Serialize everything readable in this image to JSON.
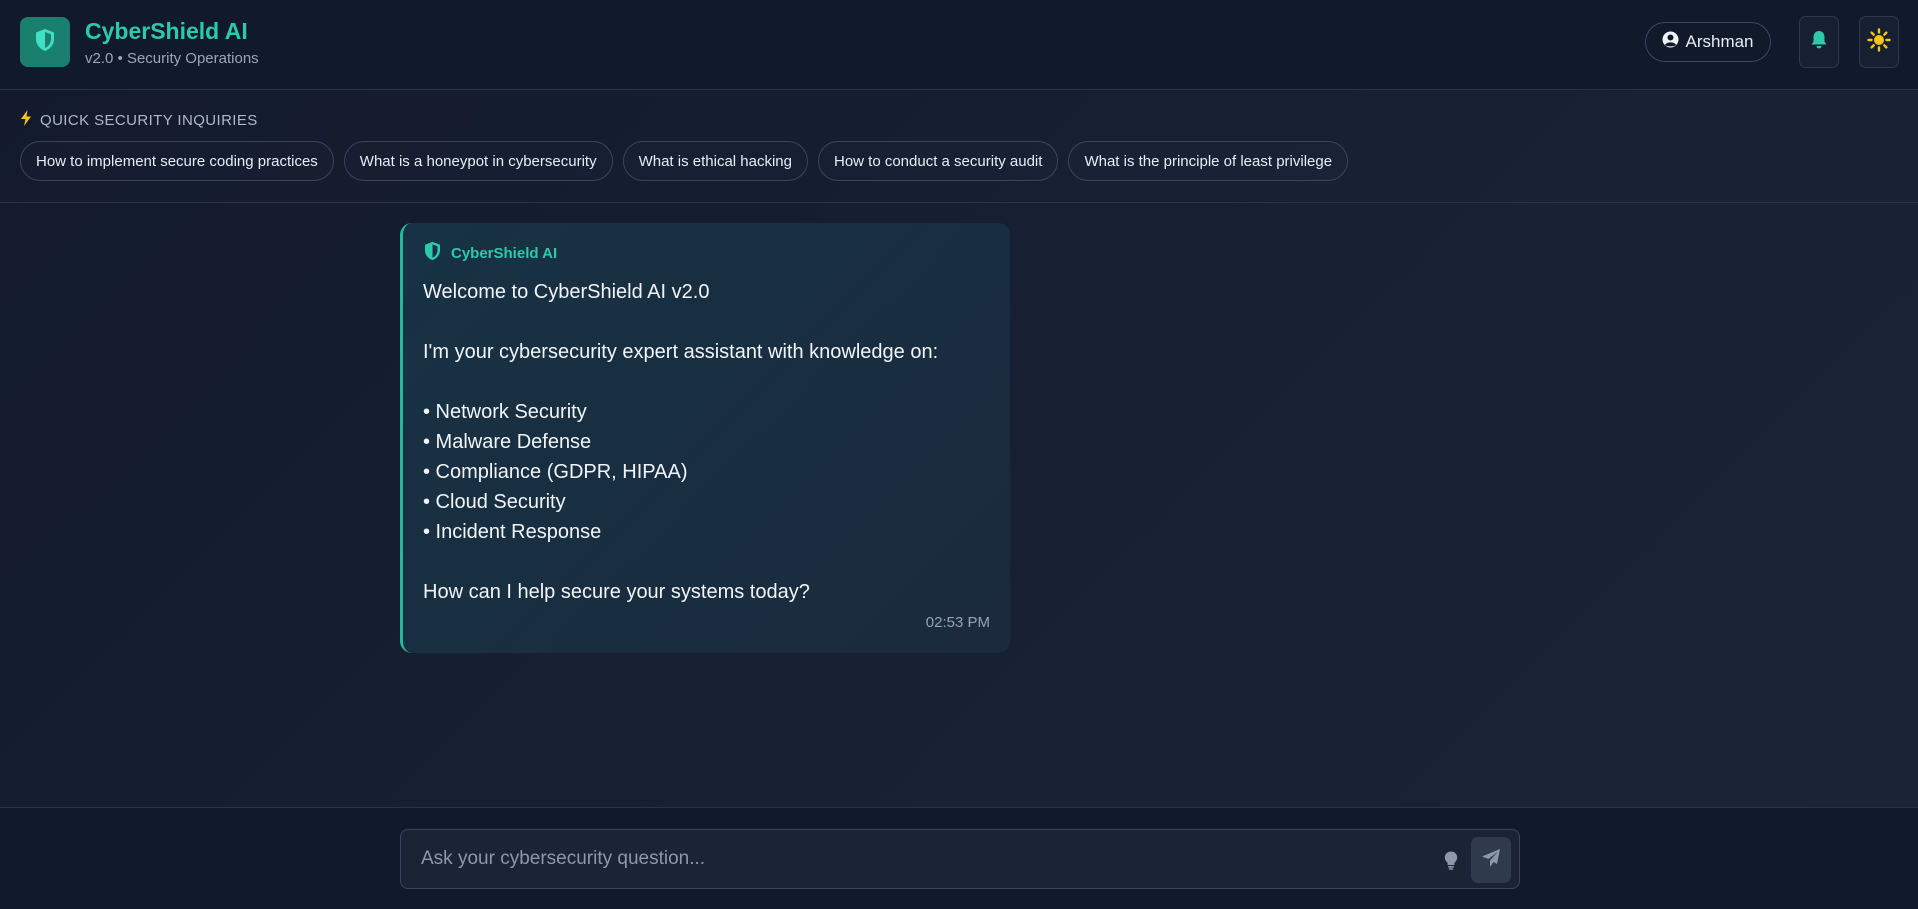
{
  "header": {
    "app_title": "CyberShield AI",
    "app_subtitle": "v2.0 • Security Operations",
    "logo_icon": "shield-icon",
    "user_name": "Arshman",
    "user_icon": "user-circle-icon",
    "notification_icon": "bell-icon",
    "theme_icon": "sun-icon"
  },
  "quick": {
    "heading": "QUICK SECURITY INQUIRIES",
    "heading_icon": "lightning-icon",
    "chips": [
      "How to implement secure coding practices",
      "What is a honeypot in cybersecurity",
      "What is ethical hacking",
      "How to conduct a security audit",
      "What is the principle of least privilege"
    ]
  },
  "message": {
    "sender": "CyberShield AI",
    "sender_icon": "shield-icon",
    "lines": [
      "Welcome to CyberShield AI v2.0",
      "",
      "I'm your cybersecurity expert assistant with knowledge on:",
      "",
      "• Network Security",
      "• Malware Defense",
      "• Compliance (GDPR, HIPAA)",
      "• Cloud Security",
      "• Incident Response",
      "",
      "How can I help secure your systems today?"
    ],
    "time": "02:53 PM"
  },
  "input": {
    "placeholder": "Ask your cybersecurity question...",
    "value": "",
    "suggest_icon": "lightbulb-icon",
    "send_icon": "paper-plane-icon"
  },
  "colors": {
    "accent": "#2cc9ab",
    "background": "#141c2e",
    "message_bg": "#173244",
    "theme_icon": "#f5c518"
  }
}
